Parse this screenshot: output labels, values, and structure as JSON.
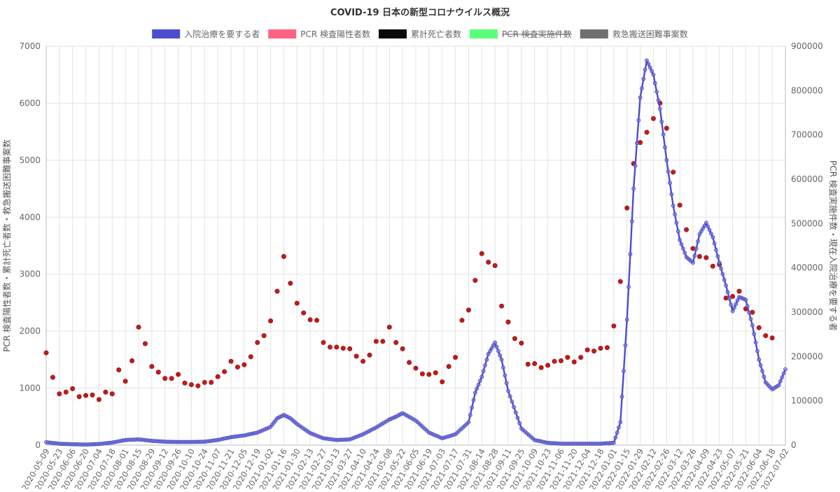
{
  "chart_data": {
    "type": "line",
    "title": "COVID-19 日本の新型コロナウイルス概況",
    "legend": {
      "placement": "top-center",
      "items": [
        {
          "label": "入院治療を要する者",
          "color": "#4c4ccf",
          "hidden": false
        },
        {
          "label": "PCR 検査陽性者数",
          "color": "#ff6384",
          "hidden": false
        },
        {
          "label": "累計死亡者数",
          "color": "#0a0a0a",
          "hidden": false
        },
        {
          "label": "PCR 検査実施件数",
          "color": "#5cff7a",
          "hidden": true
        },
        {
          "label": "救急搬送困難事案数",
          "color": "#707070",
          "hidden": false
        }
      ]
    },
    "y_left": {
      "label": "PCR 検査陽性者数・累計死亡者数・救急搬送困難事案数",
      "min": 0,
      "max": 7000,
      "ticks": [
        "0",
        "1000",
        "2000",
        "3000",
        "4000",
        "5000",
        "6000",
        "7000"
      ]
    },
    "y_right": {
      "label": "PCR 検査実施件数・現在入院治療を要する者",
      "min": 0,
      "max": 900000,
      "ticks": [
        "0",
        "100000",
        "200000",
        "300000",
        "400000",
        "500000",
        "600000",
        "700000",
        "800000",
        "900000"
      ]
    },
    "x_start": "2020-05-09",
    "x_end": "2022-07-02",
    "x_ticks": [
      "2020-05-09",
      "2020-05-23",
      "2020-06-06",
      "2020-06-20",
      "2020-07-04",
      "2020-07-18",
      "2020-08-01",
      "2020-08-15",
      "2020-08-29",
      "2020-09-12",
      "2020-09-26",
      "2020-10-10",
      "2020-10-24",
      "2020-11-07",
      "2020-11-21",
      "2020-12-05",
      "2020-12-19",
      "2021-01-02",
      "2021-01-16",
      "2021-01-30",
      "2021-02-13",
      "2021-02-27",
      "2021-03-13",
      "2021-03-27",
      "2021-04-10",
      "2021-04-24",
      "2021-05-08",
      "2021-05-22",
      "2021-06-05",
      "2021-06-19",
      "2021-07-03",
      "2021-07-17",
      "2021-07-31",
      "2021-08-14",
      "2021-08-28",
      "2021-09-11",
      "2021-09-25",
      "2021-10-09",
      "2021-10-23",
      "2021-11-06",
      "2021-11-20",
      "2021-12-04",
      "2021-12-18",
      "2022-01-01",
      "2022-01-15",
      "2022-01-29",
      "2022-02-12",
      "2022-02-26",
      "2022-03-12",
      "2022-03-26",
      "2022-04-09",
      "2022-04-23",
      "2022-05-07",
      "2022-05-21",
      "2022-06-04",
      "2022-06-18",
      "2022-07-02"
    ],
    "grid": true,
    "series": [
      {
        "name": "入院治療を要する者",
        "axis": "left",
        "style": "line-with-points",
        "x": [
          "2020-05-09",
          "2020-05-23",
          "2020-06-06",
          "2020-06-20",
          "2020-07-04",
          "2020-07-18",
          "2020-08-01",
          "2020-08-15",
          "2020-08-29",
          "2020-09-12",
          "2020-09-26",
          "2020-10-10",
          "2020-10-24",
          "2020-11-07",
          "2020-11-21",
          "2020-12-05",
          "2020-12-19",
          "2021-01-02",
          "2021-01-09",
          "2021-01-16",
          "2021-01-23",
          "2021-01-30",
          "2021-02-13",
          "2021-02-27",
          "2021-03-13",
          "2021-03-27",
          "2021-04-10",
          "2021-04-24",
          "2021-05-08",
          "2021-05-15",
          "2021-05-22",
          "2021-06-05",
          "2021-06-19",
          "2021-07-03",
          "2021-07-17",
          "2021-07-31",
          "2021-08-07",
          "2021-08-14",
          "2021-08-21",
          "2021-08-28",
          "2021-09-04",
          "2021-09-11",
          "2021-09-25",
          "2021-10-09",
          "2021-10-23",
          "2021-11-06",
          "2021-11-20",
          "2021-12-04",
          "2021-12-18",
          "2022-01-01",
          "2022-01-08",
          "2022-01-15",
          "2022-01-22",
          "2022-01-29",
          "2022-02-05",
          "2022-02-12",
          "2022-02-19",
          "2022-02-26",
          "2022-03-05",
          "2022-03-12",
          "2022-03-19",
          "2022-03-26",
          "2022-04-02",
          "2022-04-09",
          "2022-04-16",
          "2022-04-23",
          "2022-04-30",
          "2022-05-07",
          "2022-05-14",
          "2022-05-21",
          "2022-05-28",
          "2022-06-04",
          "2022-06-11",
          "2022-06-18",
          "2022-06-25",
          "2022-07-02"
        ],
        "values": [
          50,
          25,
          15,
          10,
          20,
          45,
          90,
          100,
          75,
          60,
          55,
          55,
          60,
          90,
          140,
          170,
          220,
          320,
          470,
          530,
          470,
          370,
          210,
          120,
          90,
          100,
          190,
          310,
          450,
          500,
          560,
          430,
          220,
          120,
          190,
          400,
          920,
          1200,
          1600,
          1800,
          1500,
          950,
          290,
          90,
          40,
          25,
          25,
          25,
          25,
          40,
          400,
          2200,
          4500,
          6100,
          6750,
          6500,
          5900,
          5000,
          4200,
          3600,
          3300,
          3200,
          3700,
          3900,
          3650,
          3200,
          2800,
          2350,
          2600,
          2550,
          2100,
          1500,
          1100,
          980,
          1050,
          1330
        ]
      },
      {
        "name": "PCR 検査陽性者数",
        "axis": "left",
        "style": "points",
        "x": [
          "2020-05-09",
          "2020-05-16",
          "2020-05-23",
          "2020-05-30",
          "2020-06-06",
          "2020-06-13",
          "2020-06-20",
          "2020-06-27",
          "2020-07-04",
          "2020-07-11",
          "2020-07-18",
          "2020-07-25",
          "2020-08-01",
          "2020-08-08",
          "2020-08-15",
          "2020-08-22",
          "2020-08-29",
          "2020-09-05",
          "2020-09-12",
          "2020-09-19",
          "2020-09-26",
          "2020-10-03",
          "2020-10-10",
          "2020-10-17",
          "2020-10-24",
          "2020-10-31",
          "2020-11-07",
          "2020-11-14",
          "2020-11-21",
          "2020-11-28",
          "2020-12-05",
          "2020-12-12",
          "2020-12-19",
          "2020-12-26",
          "2021-01-02",
          "2021-01-09",
          "2021-01-16",
          "2021-01-23",
          "2021-01-30",
          "2021-02-06",
          "2021-02-13",
          "2021-02-20",
          "2021-02-27",
          "2021-03-06",
          "2021-03-13",
          "2021-03-20",
          "2021-03-27",
          "2021-04-03",
          "2021-04-10",
          "2021-04-17",
          "2021-04-24",
          "2021-05-01",
          "2021-05-08",
          "2021-05-15",
          "2021-05-22",
          "2021-05-29",
          "2021-06-05",
          "2021-06-12",
          "2021-06-19",
          "2021-06-26",
          "2021-07-03",
          "2021-07-10",
          "2021-07-17",
          "2021-07-24",
          "2021-07-31",
          "2021-08-07",
          "2021-08-14",
          "2021-08-21",
          "2021-08-28",
          "2021-09-04",
          "2021-09-11",
          "2021-09-18",
          "2021-09-25",
          "2021-10-02",
          "2021-10-09",
          "2021-10-16",
          "2021-10-23",
          "2021-10-30",
          "2021-11-06",
          "2021-11-13",
          "2021-11-20",
          "2021-11-27",
          "2021-12-04",
          "2021-12-11",
          "2021-12-18",
          "2021-12-25",
          "2022-01-01",
          "2022-01-08",
          "2022-01-15",
          "2022-01-22",
          "2022-01-29",
          "2022-02-05",
          "2022-02-12",
          "2022-02-19",
          "2022-02-26",
          "2022-03-05",
          "2022-03-12",
          "2022-03-19",
          "2022-03-26",
          "2022-04-02",
          "2022-04-09",
          "2022-04-16",
          "2022-04-23",
          "2022-04-30",
          "2022-05-07",
          "2022-05-14",
          "2022-05-21",
          "2022-05-28",
          "2022-06-04",
          "2022-06-11",
          "2022-06-18"
        ],
        "values": [
          1620,
          1190,
          900,
          930,
          990,
          850,
          870,
          880,
          800,
          930,
          900,
          1320,
          1120,
          1480,
          2070,
          1780,
          1380,
          1280,
          1170,
          1170,
          1240,
          1090,
          1060,
          1040,
          1100,
          1100,
          1200,
          1290,
          1470,
          1370,
          1410,
          1550,
          1800,
          1920,
          2180,
          2700,
          3310,
          2840,
          2490,
          2320,
          2200,
          2190,
          1800,
          1720,
          1720,
          1700,
          1690,
          1560,
          1470,
          1580,
          1820,
          1820,
          2070,
          1800,
          1690,
          1450,
          1350,
          1250,
          1240,
          1270,
          1110,
          1380,
          1540,
          2190,
          2370,
          2890,
          3360,
          3210,
          3150,
          2440,
          2160,
          1870,
          1790,
          1420,
          1430,
          1360,
          1400,
          1470,
          1480,
          1540,
          1460,
          1540,
          1670,
          1650,
          1700,
          1710,
          2090,
          2870,
          4160,
          4940,
          5310,
          5490,
          5730,
          6000,
          5560,
          4790,
          4210,
          3780,
          3450,
          3310,
          3290,
          3140,
          3170,
          2580,
          2610,
          2700,
          2390,
          2330,
          2060,
          1920,
          1880
        ]
      }
    ]
  }
}
